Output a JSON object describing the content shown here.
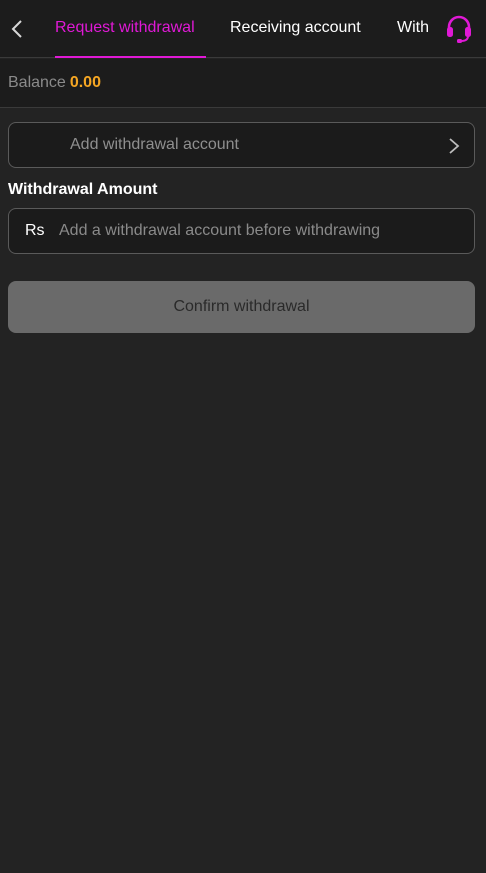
{
  "header": {
    "tabs": [
      {
        "label": "Request withdrawal",
        "active": true
      },
      {
        "label": "Receiving account",
        "active": false
      },
      {
        "label": "With",
        "active": false
      }
    ],
    "back_icon": "chevron-left-icon",
    "support_icon": "headset-icon",
    "accent_color": "#e019d6"
  },
  "balance": {
    "label": "Balance",
    "value": "0.00",
    "value_color": "#f5a623"
  },
  "account": {
    "placeholder_text": "Add withdrawal account",
    "icon": "chevron-right-icon"
  },
  "amount": {
    "label": "Withdrawal Amount",
    "currency": "Rs",
    "placeholder": "Add a withdrawal account before withdrawing"
  },
  "confirm": {
    "label": "Confirm withdrawal"
  }
}
